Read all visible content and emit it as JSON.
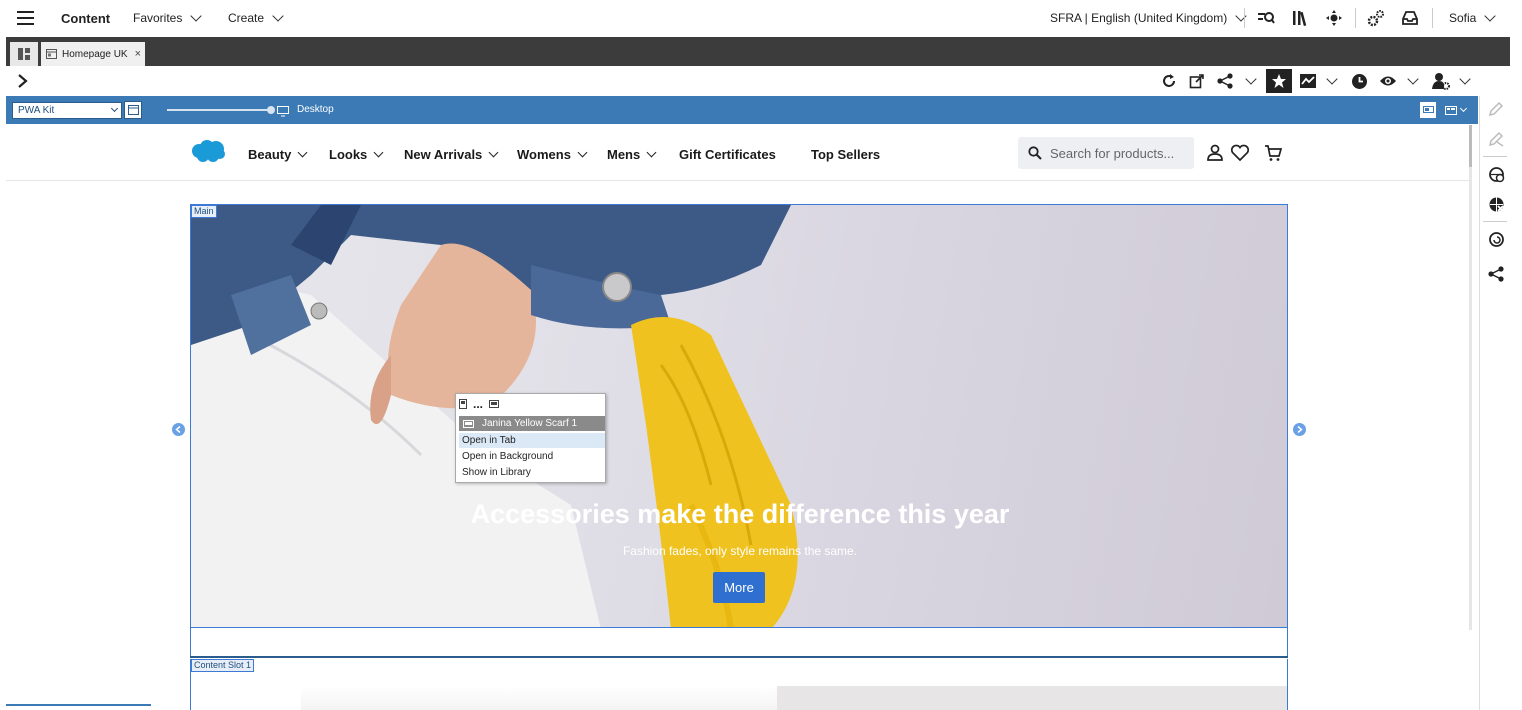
{
  "topbar": {
    "app_title": "Content",
    "favorites": "Favorites",
    "create": "Create",
    "site_locale": "SFRA | English (United Kingdom)",
    "user": "Sofia"
  },
  "tabs": [
    {
      "label": "Homepage UK",
      "close": "×"
    }
  ],
  "preview_bar": {
    "site_select": "PWA Kit",
    "device_label": "Desktop",
    "zoom_fraction": 1.0
  },
  "storefront": {
    "nav": [
      "Beauty",
      "Looks",
      "New Arrivals",
      "Womens",
      "Mens",
      "Gift Certificates",
      "Top Sellers"
    ],
    "nav_has_dropdown": [
      true,
      true,
      true,
      true,
      true,
      false,
      false
    ],
    "search_placeholder": "Search for products...",
    "main_slot_label": "Main",
    "hero_headline": "Accessories make the difference this year",
    "hero_subtext": "Fashion fades, only style remains the same.",
    "hero_button": "More",
    "content_slot_label": "Content Slot 1"
  },
  "context_menu": {
    "header_dots": "...",
    "item_title": "Janina Yellow Scarf 1",
    "items": [
      "Open in Tab",
      "Open in Background",
      "Show in Library"
    ]
  },
  "colors": {
    "accent_blue": "#3b7ab5",
    "hero_border": "#3d7ad6",
    "button_blue": "#2f6fd0",
    "menu_highlight": "#dbe9f7",
    "menu_title_bg": "#8a8a8a"
  }
}
